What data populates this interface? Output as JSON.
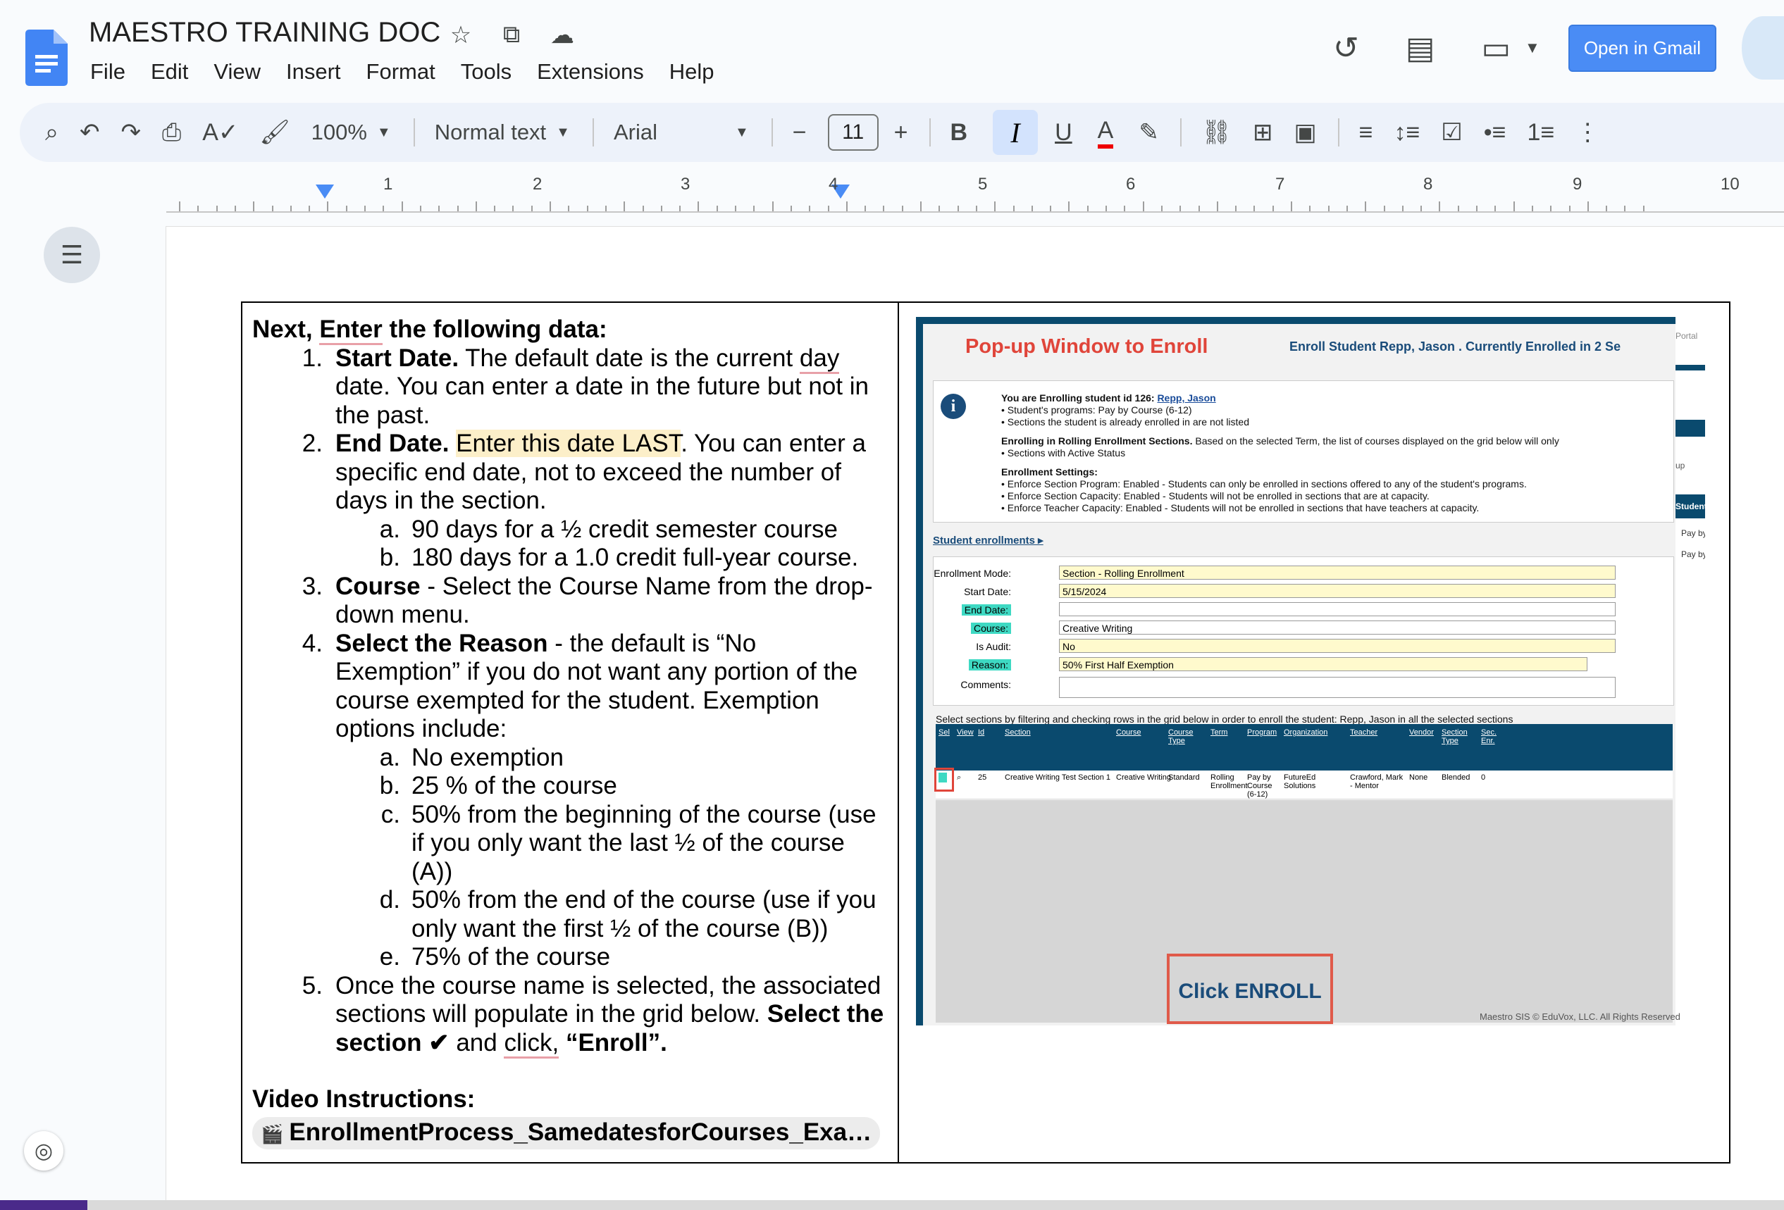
{
  "header": {
    "title": "MAESTRO TRAINING DOC",
    "menus": [
      "File",
      "Edit",
      "View",
      "Insert",
      "Format",
      "Tools",
      "Extensions",
      "Help"
    ],
    "open_gmail": "Open in Gmail"
  },
  "toolbar": {
    "zoom": "100%",
    "style": "Normal text",
    "font": "Arial",
    "font_size": "11"
  },
  "ruler": {
    "numbers": [
      "1",
      "2",
      "3",
      "4",
      "5",
      "6",
      "7",
      "8",
      "9",
      "10"
    ]
  },
  "doc": {
    "heading_pre": "Next, ",
    "heading_enter": "Enter",
    "heading_post": " the following data:",
    "item1_num": "1.",
    "item1_bold": "Start Date.",
    "item1_text_a": "  The default date is the current ",
    "item1_day": "day",
    "item1_text_b": " date.  You can enter a date in the future but not in the past.",
    "item2_num": "2.",
    "item2_bold": "End Date.",
    "item2_highlight": "Enter this date LAST",
    "item2_text": ". You can enter a specific end date, not to exceed the number of days in the section.",
    "item2a_num": "a.",
    "item2a": "90 days for a ½ credit semester course",
    "item2b_num": "b.",
    "item2b": "180 days for a 1.0 credit full-year course.",
    "item3_num": "3.",
    "item3_bold": "Course",
    "item3_text": " - Select the Course Name from the drop-down menu.",
    "item4_num": "4.",
    "item4_bold": "Select the Reason",
    "item4_text": " - the default is “No Exemption” if you do not want any portion of the course exempted for the student. Exemption options include:",
    "item4a_num": "a.",
    "item4a": "No exemption",
    "item4b_num": "b.",
    "item4b": "25 % of the course",
    "item4c_num": "c.",
    "item4c": "50% from the beginning of the course (use if you only want the last ½ of the course (A))",
    "item4d_num": "d.",
    "item4d": "50% from the end of the course (use if you only want the first ½ of the course (B))",
    "item4e_num": "e.",
    "item4e": "75% of the course",
    "item5_num": "5.",
    "item5_text_a": "Once the course name is selected, the associated sections will populate in the grid below.  ",
    "item5_bold_a": "Select the section ✔",
    "item5_text_b": "  and ",
    "item5_click": "click,",
    "item5_bold_b": " “Enroll”.",
    "video_heading": "Video Instructions:",
    "video_chip": "EnrollmentProcess_SamedatesforCourses_Exa…"
  },
  "screenshot": {
    "popup_title": "Pop-up Window to Enroll",
    "popup_sub": "Enroll Student Repp, Jason . Currently Enrolled in 2 Se",
    "portal": "Portal",
    "info_line1_a": "You are Enrolling student id 126: ",
    "info_line1_link": "Repp, Jason",
    "info_b1": "• Student's programs: Pay by Course (6-12)",
    "info_b2": "• Sections the student is already enrolled in are not listed",
    "info_rolling_bold": "Enrolling in Rolling Enrollment Sections.",
    "info_rolling_text": " Based on the selected Term, the list of courses displayed on the grid below will only",
    "info_b3": "• Sections with Active Status",
    "info_settings": "Enrollment Settings:",
    "info_s1": "• Enforce Section Program: Enabled - Students can only be enrolled in sections offered to any of the student's programs.",
    "info_s2": "• Enforce Section Capacity: Enabled - Students will not be enrolled in sections that are at capacity.",
    "info_s3": "• Enforce Teacher Capacity: Enabled - Students will not be enrolled in sections that have teachers at capacity.",
    "student_enrollments": "Student enrollments ▸",
    "form": {
      "mode_label": "Enrollment Mode:",
      "mode_val": "Section - Rolling Enrollment",
      "start_label": "Start Date:",
      "start_val": "5/15/2024",
      "end_label": "End Date:",
      "end_val": "",
      "course_label": "Course:",
      "course_val": "Creative Writing",
      "audit_label": "Is Audit:",
      "audit_val": "No",
      "reason_label": "Reason:",
      "reason_val": "50% First Half Exemption",
      "comments_label": "Comments:"
    },
    "grid_caption": "Select sections by filtering and checking rows in the grid below in order to enroll the student: Repp, Jason in all the selected sections",
    "grid_headers": [
      "Sel",
      "View",
      "Id",
      "Section",
      "Course",
      "Course Type",
      "Term",
      "Program",
      "Organization",
      "Teacher",
      "Vendor",
      "Section Type",
      "Sec. Enr."
    ],
    "grid_row": [
      "25",
      "Creative Writing Test Section 1",
      "Creative Writing",
      "Standard",
      "Rolling Enrollment",
      "Pay by Course (6-12)",
      "FutureEd Solutions",
      "Crawford, Mark - Mentor",
      "None",
      "Blended",
      "0"
    ],
    "side_student": "Student",
    "side_payby1": "Pay by",
    "side_payby2": "Pay by",
    "side_up": "up",
    "callout": "Click ENROLL",
    "footer": "Maestro SIS © EduVox, LLC. All Rights Reserved"
  }
}
